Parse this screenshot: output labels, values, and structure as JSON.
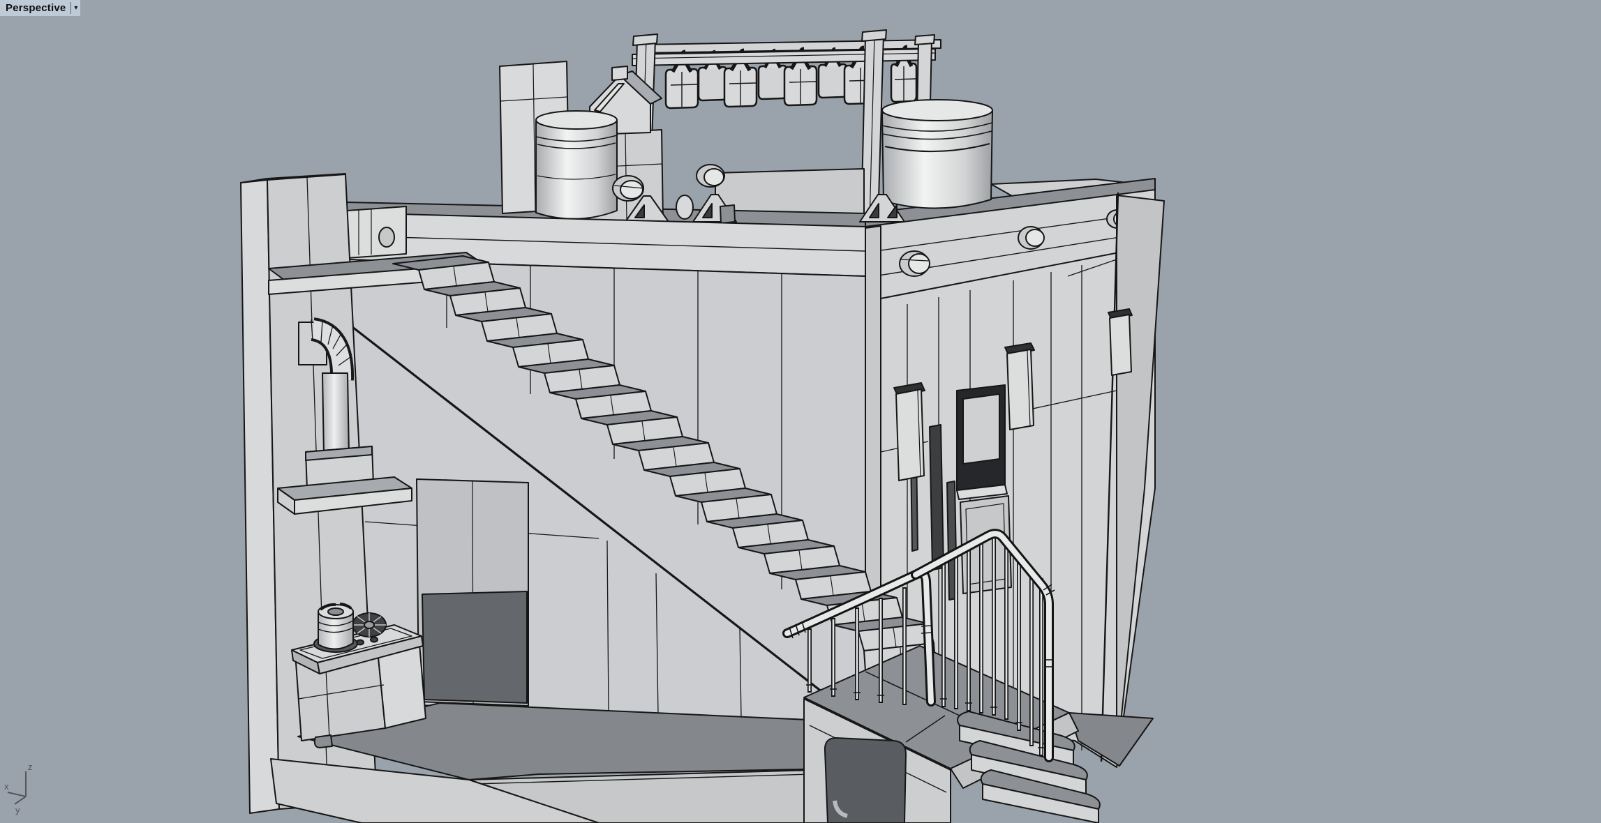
{
  "viewport": {
    "title": "Perspective",
    "dropdown_icon": "▾"
  },
  "axis_gizmo": {
    "x_label": "x",
    "y_label": "y",
    "z_label": "z"
  },
  "colors": {
    "background": "#9aa2ab",
    "label_bg": "#bfcad7",
    "label_text": "#0d0d0d",
    "edge_line": "#161616",
    "face_light": "#dcdddd",
    "face_mid": "#cdcfd1",
    "face_shade": "#c2c4c6",
    "deck_surface_dark": "#8d9095",
    "floor_dark": "#84878c",
    "opening_dark": "#5c5f63",
    "gizmo": "#54575c"
  },
  "scene": {
    "type": "3d-cad-shaded-model",
    "subject": "cutaway room model with rooftop deck, hanging rack, tanks, long staircase, stove and railed landing",
    "counts": {
      "hanging_bags": 9,
      "stair_steps": 15,
      "railing_balusters": 14,
      "wall_sconces": 3,
      "deck_pipe_stubs": 5,
      "stove_burners": 2,
      "tanks": 2
    }
  }
}
